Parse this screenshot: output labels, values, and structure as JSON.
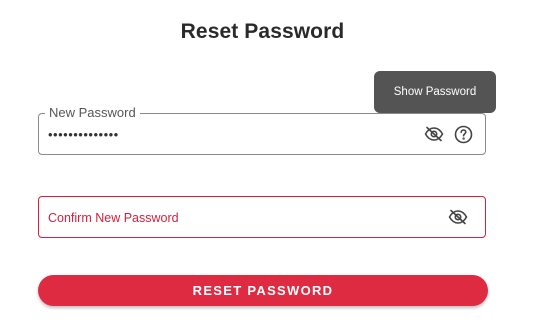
{
  "page": {
    "title": "Reset Password"
  },
  "new_password": {
    "label": "New Password",
    "value": "••••••••••••••"
  },
  "tooltip": {
    "text": "Show Password"
  },
  "confirm_password": {
    "placeholder": "Confirm New Password"
  },
  "reset_button": {
    "label": "RESET PASSWORD"
  },
  "icons": {
    "toggle_visibility": "eye-slash-icon",
    "help": "question-circle-icon"
  },
  "colors": {
    "accent": "#df2b42",
    "error_border": "#d2223f",
    "tooltip_bg": "#545454",
    "title_text": "#2a2a2a"
  }
}
